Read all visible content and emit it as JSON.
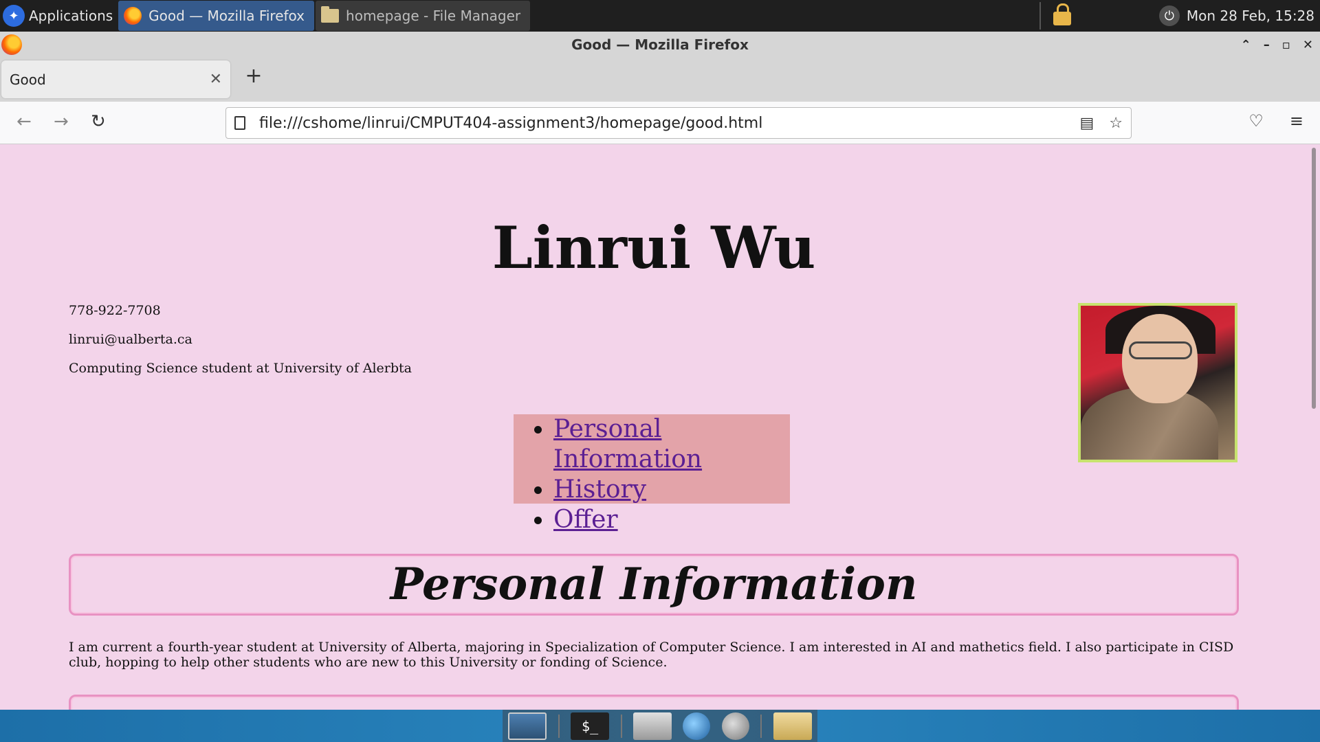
{
  "top_panel": {
    "applications_label": "Applications",
    "tasks": [
      {
        "label": "Good — Mozilla Firefox",
        "active": true
      },
      {
        "label": "homepage - File Manager",
        "active": false
      }
    ],
    "clock": "Mon 28 Feb, 15:28"
  },
  "window": {
    "title": "Good — Mozilla Firefox"
  },
  "browser": {
    "tab_title": "Good",
    "url": "file:///cshome/linrui/CMPUT404-assignment3/homepage/good.html"
  },
  "page": {
    "name": "Linrui Wu",
    "phone": "778-922-7708",
    "email": "linrui@ualberta.ca",
    "description": "Computing Science student at University of Alerbta",
    "nav_links": [
      "Personal Information",
      "History",
      "Offer"
    ],
    "section_title": "Personal Information",
    "section_text": "I am current a fourth-year student at University of Alberta, majoring in Specialization of Computer Science. I am interested in AI and mathetics field. I also participate in CISD club, hopping to help other students who are new to this University or fonding of Science."
  },
  "colors": {
    "page_background": "#f3d4ea",
    "nav_box_background": "#e3a3a9",
    "link_color": "#5b1f93",
    "section_border": "#e892c2",
    "photo_border": "#c7e36e"
  },
  "icons": [
    "xfce-logo-icon",
    "firefox-icon",
    "folder-icon",
    "lock-icon",
    "power-icon",
    "back-icon",
    "forward-icon",
    "reload-icon",
    "page-icon",
    "reader-view-icon",
    "bookmark-star-icon",
    "pocket-icon",
    "menu-icon"
  ]
}
